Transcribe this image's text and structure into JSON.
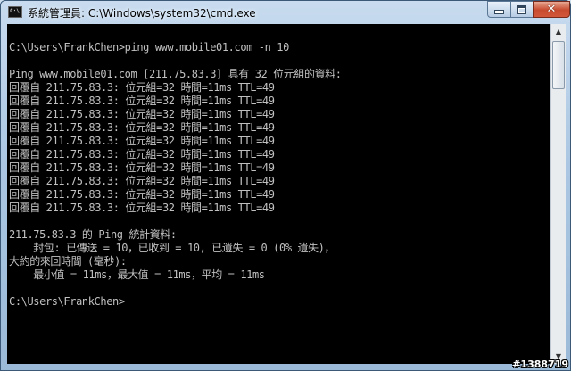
{
  "window": {
    "title": "系統管理員: C:\\Windows\\system32\\cmd.exe",
    "icon": "cmd-icon",
    "controls": {
      "minimize": "minimize-icon",
      "maximize": "maximize-icon",
      "close": "close-icon"
    }
  },
  "console": {
    "lines": [
      "",
      "C:\\Users\\FrankChen>ping www.mobile01.com -n 10",
      "",
      "Ping www.mobile01.com [211.75.83.3] 具有 32 位元組的資料:",
      "回覆自 211.75.83.3: 位元組=32 時間=11ms TTL=49",
      "回覆自 211.75.83.3: 位元組=32 時間=11ms TTL=49",
      "回覆自 211.75.83.3: 位元組=32 時間=11ms TTL=49",
      "回覆自 211.75.83.3: 位元組=32 時間=11ms TTL=49",
      "回覆自 211.75.83.3: 位元組=32 時間=11ms TTL=49",
      "回覆自 211.75.83.3: 位元組=32 時間=11ms TTL=49",
      "回覆自 211.75.83.3: 位元組=32 時間=11ms TTL=49",
      "回覆自 211.75.83.3: 位元組=32 時間=11ms TTL=49",
      "回覆自 211.75.83.3: 位元組=32 時間=11ms TTL=49",
      "回覆自 211.75.83.3: 位元組=32 時間=11ms TTL=49",
      "",
      "211.75.83.3 的 Ping 統計資料:",
      "    封包: 已傳送 = 10，已收到 = 10, 已遺失 = 0 (0% 遺失)，",
      "大約的來回時間 (毫秒):",
      "    最小值 = 11ms，最大值 = 11ms，平均 = 11ms",
      "",
      "C:\\Users\\FrankChen>"
    ]
  },
  "watermark": "#1388719",
  "colors": {
    "console_bg": "#000000",
    "console_fg": "#c0c0c0",
    "close_button": "#c74a2e"
  }
}
